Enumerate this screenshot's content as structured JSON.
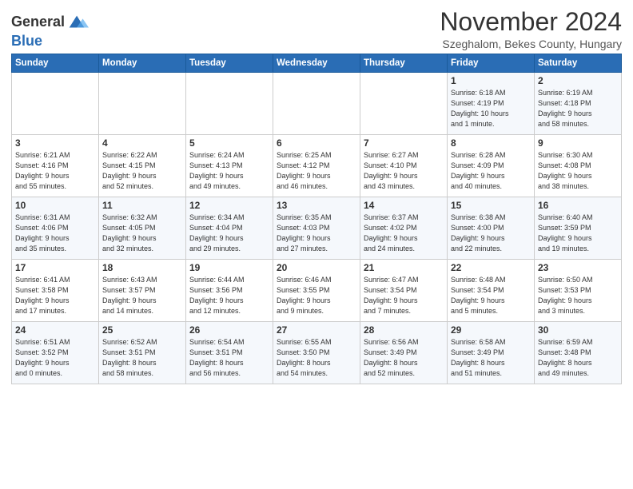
{
  "header": {
    "logo_line1": "General",
    "logo_line2": "Blue",
    "month": "November 2024",
    "location": "Szeghalom, Bekes County, Hungary"
  },
  "weekdays": [
    "Sunday",
    "Monday",
    "Tuesday",
    "Wednesday",
    "Thursday",
    "Friday",
    "Saturday"
  ],
  "weeks": [
    [
      {
        "day": "",
        "info": ""
      },
      {
        "day": "",
        "info": ""
      },
      {
        "day": "",
        "info": ""
      },
      {
        "day": "",
        "info": ""
      },
      {
        "day": "",
        "info": ""
      },
      {
        "day": "1",
        "info": "Sunrise: 6:18 AM\nSunset: 4:19 PM\nDaylight: 10 hours\nand 1 minute."
      },
      {
        "day": "2",
        "info": "Sunrise: 6:19 AM\nSunset: 4:18 PM\nDaylight: 9 hours\nand 58 minutes."
      }
    ],
    [
      {
        "day": "3",
        "info": "Sunrise: 6:21 AM\nSunset: 4:16 PM\nDaylight: 9 hours\nand 55 minutes."
      },
      {
        "day": "4",
        "info": "Sunrise: 6:22 AM\nSunset: 4:15 PM\nDaylight: 9 hours\nand 52 minutes."
      },
      {
        "day": "5",
        "info": "Sunrise: 6:24 AM\nSunset: 4:13 PM\nDaylight: 9 hours\nand 49 minutes."
      },
      {
        "day": "6",
        "info": "Sunrise: 6:25 AM\nSunset: 4:12 PM\nDaylight: 9 hours\nand 46 minutes."
      },
      {
        "day": "7",
        "info": "Sunrise: 6:27 AM\nSunset: 4:10 PM\nDaylight: 9 hours\nand 43 minutes."
      },
      {
        "day": "8",
        "info": "Sunrise: 6:28 AM\nSunset: 4:09 PM\nDaylight: 9 hours\nand 40 minutes."
      },
      {
        "day": "9",
        "info": "Sunrise: 6:30 AM\nSunset: 4:08 PM\nDaylight: 9 hours\nand 38 minutes."
      }
    ],
    [
      {
        "day": "10",
        "info": "Sunrise: 6:31 AM\nSunset: 4:06 PM\nDaylight: 9 hours\nand 35 minutes."
      },
      {
        "day": "11",
        "info": "Sunrise: 6:32 AM\nSunset: 4:05 PM\nDaylight: 9 hours\nand 32 minutes."
      },
      {
        "day": "12",
        "info": "Sunrise: 6:34 AM\nSunset: 4:04 PM\nDaylight: 9 hours\nand 29 minutes."
      },
      {
        "day": "13",
        "info": "Sunrise: 6:35 AM\nSunset: 4:03 PM\nDaylight: 9 hours\nand 27 minutes."
      },
      {
        "day": "14",
        "info": "Sunrise: 6:37 AM\nSunset: 4:02 PM\nDaylight: 9 hours\nand 24 minutes."
      },
      {
        "day": "15",
        "info": "Sunrise: 6:38 AM\nSunset: 4:00 PM\nDaylight: 9 hours\nand 22 minutes."
      },
      {
        "day": "16",
        "info": "Sunrise: 6:40 AM\nSunset: 3:59 PM\nDaylight: 9 hours\nand 19 minutes."
      }
    ],
    [
      {
        "day": "17",
        "info": "Sunrise: 6:41 AM\nSunset: 3:58 PM\nDaylight: 9 hours\nand 17 minutes."
      },
      {
        "day": "18",
        "info": "Sunrise: 6:43 AM\nSunset: 3:57 PM\nDaylight: 9 hours\nand 14 minutes."
      },
      {
        "day": "19",
        "info": "Sunrise: 6:44 AM\nSunset: 3:56 PM\nDaylight: 9 hours\nand 12 minutes."
      },
      {
        "day": "20",
        "info": "Sunrise: 6:46 AM\nSunset: 3:55 PM\nDaylight: 9 hours\nand 9 minutes."
      },
      {
        "day": "21",
        "info": "Sunrise: 6:47 AM\nSunset: 3:54 PM\nDaylight: 9 hours\nand 7 minutes."
      },
      {
        "day": "22",
        "info": "Sunrise: 6:48 AM\nSunset: 3:54 PM\nDaylight: 9 hours\nand 5 minutes."
      },
      {
        "day": "23",
        "info": "Sunrise: 6:50 AM\nSunset: 3:53 PM\nDaylight: 9 hours\nand 3 minutes."
      }
    ],
    [
      {
        "day": "24",
        "info": "Sunrise: 6:51 AM\nSunset: 3:52 PM\nDaylight: 9 hours\nand 0 minutes."
      },
      {
        "day": "25",
        "info": "Sunrise: 6:52 AM\nSunset: 3:51 PM\nDaylight: 8 hours\nand 58 minutes."
      },
      {
        "day": "26",
        "info": "Sunrise: 6:54 AM\nSunset: 3:51 PM\nDaylight: 8 hours\nand 56 minutes."
      },
      {
        "day": "27",
        "info": "Sunrise: 6:55 AM\nSunset: 3:50 PM\nDaylight: 8 hours\nand 54 minutes."
      },
      {
        "day": "28",
        "info": "Sunrise: 6:56 AM\nSunset: 3:49 PM\nDaylight: 8 hours\nand 52 minutes."
      },
      {
        "day": "29",
        "info": "Sunrise: 6:58 AM\nSunset: 3:49 PM\nDaylight: 8 hours\nand 51 minutes."
      },
      {
        "day": "30",
        "info": "Sunrise: 6:59 AM\nSunset: 3:48 PM\nDaylight: 8 hours\nand 49 minutes."
      }
    ]
  ]
}
